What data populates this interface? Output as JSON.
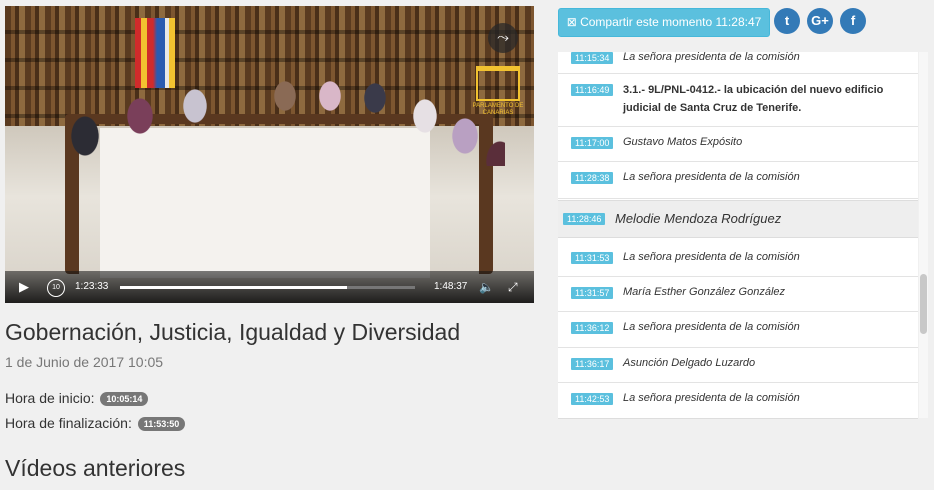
{
  "player": {
    "current_time": "1:23:33",
    "total_time": "1:48:37",
    "progress": 0.77,
    "rewind_label": "10",
    "logo_text": "PARLAMENTO DE CANARIAS"
  },
  "session": {
    "title": "Gobernación, Justicia, Igualdad y Diversidad",
    "date": "1 de Junio de 2017 10:05",
    "start_label": "Hora de inicio:",
    "start_time": "10:05:14",
    "end_label": "Hora de finalización:",
    "end_time": "11:53:50"
  },
  "previous_videos_label": "Vídeos anteriores",
  "share": {
    "label": "Compartir este momento 11:28:47",
    "icon": "share-icon",
    "social": [
      "twitter-icon",
      "google-plus-icon",
      "facebook-icon"
    ]
  },
  "timeline": [
    {
      "time": "11:15:34",
      "text": "La señora presidenta de la comisión"
    },
    {
      "time": "11:16:49",
      "text": "3.1.- 9L/PNL-0412.- la ubicación del nuevo edificio judicial de Santa Cruz de Tenerife."
    },
    {
      "time": "11:17:00",
      "text": "Gustavo Matos Expósito"
    },
    {
      "time": "11:28:38",
      "text": "La señora presidenta de la comisión"
    },
    {
      "time": "11:28:46",
      "text": "Melodie Mendoza Rodríguez"
    },
    {
      "time": "11:31:53",
      "text": "La señora presidenta de la comisión"
    },
    {
      "time": "11:31:57",
      "text": "María Esther González González"
    },
    {
      "time": "11:36:12",
      "text": "La señora presidenta de la comisión"
    },
    {
      "time": "11:36:17",
      "text": "Asunción Delgado Luzardo"
    },
    {
      "time": "11:42:53",
      "text": "La señora presidenta de la comisión"
    }
  ],
  "colors": {
    "accent": "#5bc0de",
    "social": "#337ab7",
    "badge": "#777777"
  }
}
